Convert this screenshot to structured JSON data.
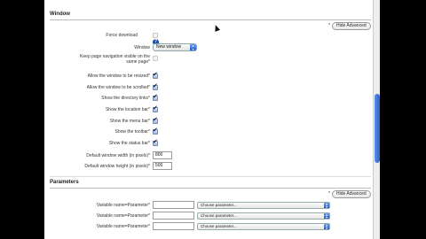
{
  "window_section": {
    "legend": "Window",
    "hide_advanced": "Hide Advanced",
    "required_mark": "*",
    "force_download_label": "Force download",
    "window_label": "Window",
    "window_select": "New window",
    "keep_nav_label_1": "Keep page navigation visible on the",
    "keep_nav_label_2": "same page",
    "allow_resize_label": "Allow the window to be resized",
    "allow_scroll_label": "Allow the window to be scrolled",
    "show_directory_label": "Show the directory links",
    "show_location_label": "Show the location bar",
    "show_menu_label": "Show the menu bar",
    "show_toolbar_label": "Show the toolbar",
    "show_status_label": "Show the status bar",
    "width_label": "Default window width (in pixels)",
    "width_value": "800",
    "height_label": "Default window height (in pixels)",
    "height_value": "500"
  },
  "parameters_section": {
    "legend": "Parameters",
    "hide_advanced": "Hide Advanced",
    "variable_label": "Variable name=Parameter",
    "choose_parameter": "Choose parameter..."
  },
  "help_icon_text": "?",
  "check_mark": "✔",
  "asterisk": "*"
}
